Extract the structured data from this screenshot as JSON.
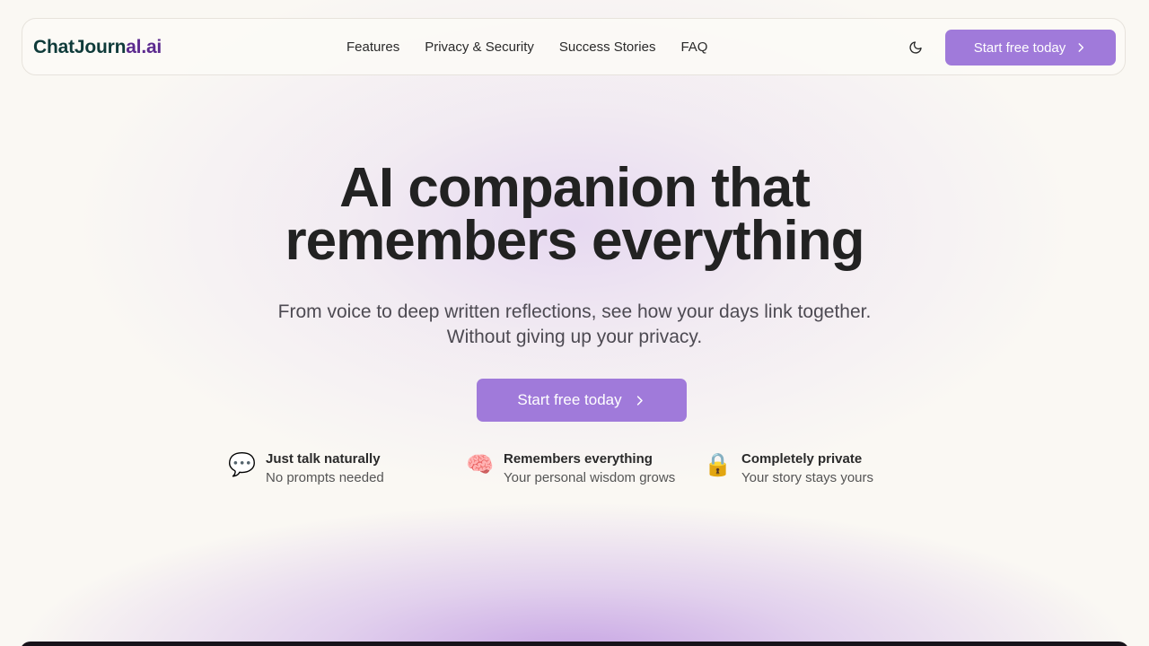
{
  "brand": {
    "part1": "ChatJourn",
    "part2": "al.ai",
    "colors": {
      "primary": "#0f3b3a",
      "secondary": "#5c2a8f"
    }
  },
  "nav": {
    "links": [
      "Features",
      "Privacy & Security",
      "Success Stories",
      "FAQ"
    ],
    "theme_toggle_icon": "moon-icon",
    "cta_label": "Start free today",
    "cta_icon": "chevron-right-icon"
  },
  "hero": {
    "title_line1": "AI companion that",
    "title_line2": "remembers everything",
    "subtitle_line1": "From voice to deep written reflections, see how your days link together.",
    "subtitle_line2": "Without giving up your privacy.",
    "cta_label": "Start free today",
    "cta_icon": "chevron-right-icon"
  },
  "features": [
    {
      "emoji": "💬",
      "icon": "speech-bubble-icon",
      "title": "Just talk naturally",
      "desc": "No prompts needed"
    },
    {
      "emoji": "🧠",
      "icon": "brain-icon",
      "title": "Remembers everything",
      "desc": "Your personal wisdom grows"
    },
    {
      "emoji": "🔒",
      "icon": "lock-icon",
      "title": "Completely private",
      "desc": "Your story stays yours"
    }
  ],
  "colors": {
    "accent": "#a07ada",
    "background": "#faf8f3",
    "text": "#222222"
  }
}
